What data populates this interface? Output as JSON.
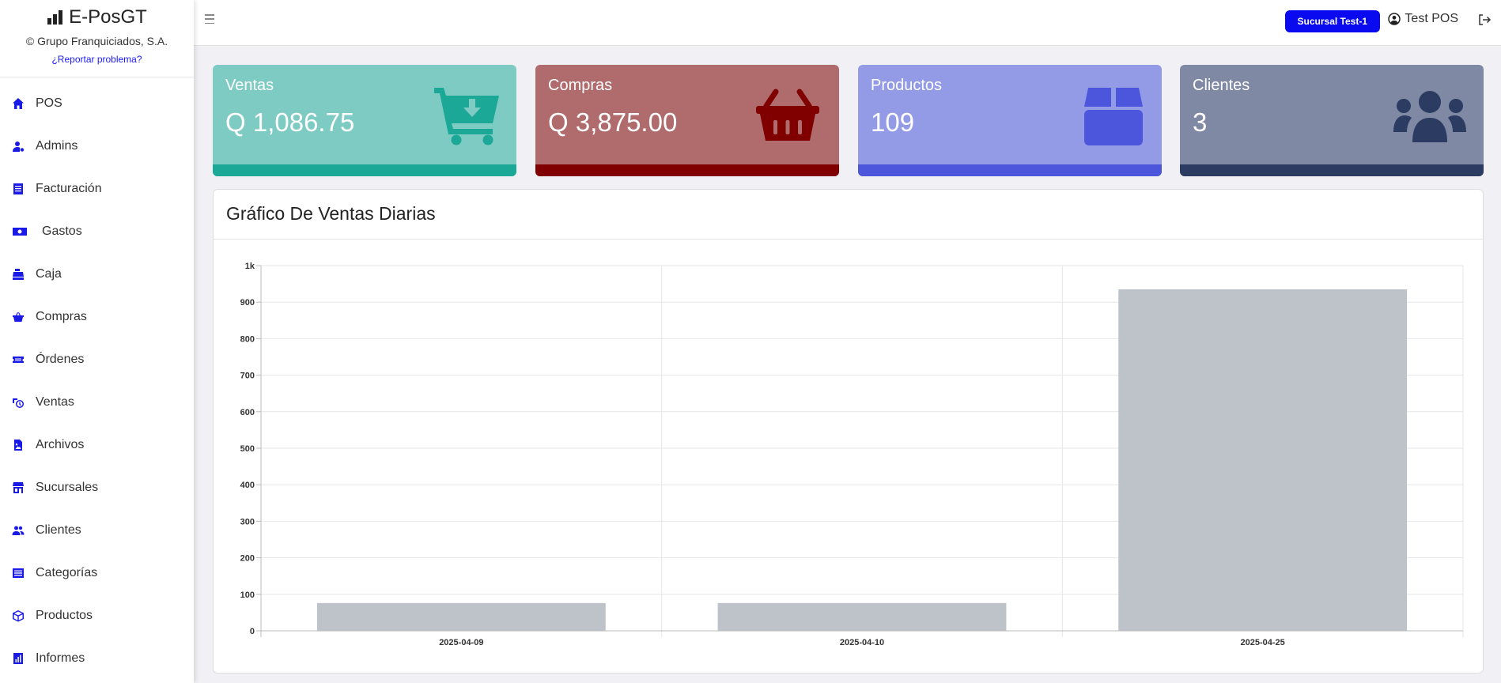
{
  "brand": {
    "name": "E-PosGT",
    "company": "© Grupo Franquiciados, S.A.",
    "report_link": "¿Reportar problema?"
  },
  "nav": [
    {
      "label": "POS",
      "icon": "home-icon"
    },
    {
      "label": "Admins",
      "icon": "user-gear-icon"
    },
    {
      "label": "Facturación",
      "icon": "receipt-icon"
    },
    {
      "label": "Gastos",
      "icon": "money-bill-icon"
    },
    {
      "label": "Caja",
      "icon": "cash-register-icon"
    },
    {
      "label": "Compras",
      "icon": "basket-icon"
    },
    {
      "label": "Órdenes",
      "icon": "ticket-icon"
    },
    {
      "label": "Ventas",
      "icon": "sales-clock-icon"
    },
    {
      "label": "Archivos",
      "icon": "file-image-icon"
    },
    {
      "label": "Sucursales",
      "icon": "store-icon"
    },
    {
      "label": "Clientes",
      "icon": "users-icon"
    },
    {
      "label": "Categorías",
      "icon": "list-icon"
    },
    {
      "label": "Productos",
      "icon": "box-icon"
    },
    {
      "label": "Informes",
      "icon": "report-chart-icon"
    }
  ],
  "topbar": {
    "branch": "Sucursal Test-1",
    "user": "Test POS"
  },
  "cards": [
    {
      "label": "Ventas",
      "value": "Q 1,086.75",
      "icon": "cart-download-icon",
      "bg": "#7ecbc4",
      "accent": "#1ba896"
    },
    {
      "label": "Compras",
      "value": "Q 3,875.00",
      "icon": "basket-icon",
      "bg": "#b06b6d",
      "accent": "#800000"
    },
    {
      "label": "Productos",
      "value": "109",
      "icon": "box-icon",
      "bg": "#939be6",
      "accent": "#4c56dc"
    },
    {
      "label": "Clientes",
      "value": "3",
      "icon": "users-icon",
      "bg": "#8089a3",
      "accent": "#2b3b62"
    }
  ],
  "chart": {
    "title": "Gráfico De Ventas Diarias"
  },
  "chart_data": {
    "type": "bar",
    "categories": [
      "2025-04-09",
      "2025-04-10",
      "2025-04-25"
    ],
    "values": [
      76,
      76,
      935
    ],
    "ylim": [
      0,
      1000
    ],
    "yticks": [
      "0",
      "100",
      "200",
      "300",
      "400",
      "500",
      "600",
      "700",
      "800",
      "900",
      "1k"
    ],
    "grid": true,
    "bar_color": "#bdc3c9"
  }
}
